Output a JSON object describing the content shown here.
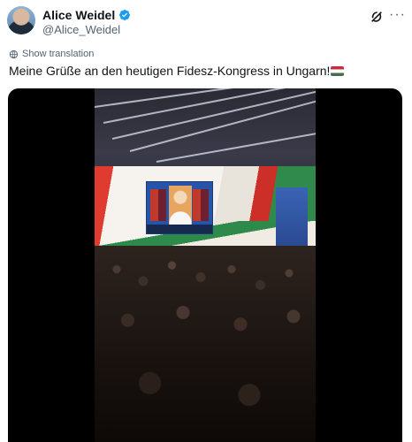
{
  "author": {
    "display_name": "Alice Weidel",
    "handle": "@Alice_Weidel",
    "verified": true
  },
  "header_icons": {
    "grok": "grok-icon",
    "more": "more-icon",
    "more_glyph": "···"
  },
  "translate": {
    "label": "Show translation",
    "icon": "globe-translate-icon"
  },
  "tweet": {
    "text": "Meine Grüße an den heutigen Fidesz-Kongress in Ungarn!",
    "flag": "hungary-flag-emoji"
  },
  "media": {
    "type": "video",
    "description_colors": {
      "accent": "#1d9bf0"
    }
  }
}
